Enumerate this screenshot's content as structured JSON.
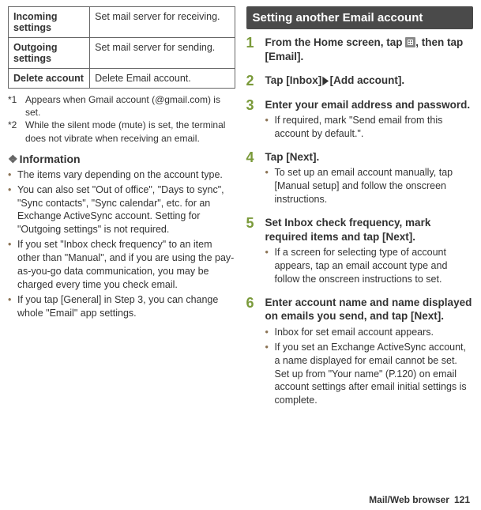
{
  "table": {
    "r1c1": "Incoming settings",
    "r1c2": "Set mail server for receiving.",
    "r2c1": "Outgoing settings",
    "r2c2": "Set mail server for sending.",
    "r3c1": "Delete account",
    "r3c2": "Delete Email account."
  },
  "foot": {
    "n1": "*1",
    "t1": "Appears when Gmail account (@gmail.com) is set.",
    "n2": "*2",
    "t2": "While the silent mode (mute) is set, the terminal does not vibrate when receiving an email."
  },
  "info": {
    "h": "Information",
    "b1": "The items vary depending on the account type.",
    "b2": "You can also set \"Out of office\", \"Days to sync\", \"Sync contacts\", \"Sync calendar\", etc. for an Exchange ActiveSync account. Setting for \"Outgoing settings\" is not required.",
    "b3": "If you set \"Inbox check frequency\" to an item other than \"Manual\", and if you are using the pay-as-you-go data communication, you may be charged every time you check email.",
    "b4": "If you tap [General] in Step 3, you can change whole \"Email\" app settings."
  },
  "banner": "Setting another Email account",
  "steps": {
    "s1": {
      "n": "1",
      "t_a": "From the Home screen, tap ",
      "t_b": ", then tap [Email]."
    },
    "s2": {
      "n": "2",
      "t_a": "Tap [Inbox]",
      "t_b": "[Add account]."
    },
    "s3": {
      "n": "3",
      "t": "Enter your email address and password.",
      "b1": "If required, mark \"Send email from this account by default.\"."
    },
    "s4": {
      "n": "4",
      "t": "Tap [Next].",
      "b1": "To set up an email account manually, tap [Manual setup] and follow the onscreen instructions."
    },
    "s5": {
      "n": "5",
      "t": "Set Inbox check frequency, mark required items and tap [Next].",
      "b1": "If a screen for selecting type of account appears, tap an email account type and follow the onscreen instructions to set."
    },
    "s6": {
      "n": "6",
      "t": "Enter account name and name displayed on emails you send, and tap [Next].",
      "b1": "Inbox for set email account appears.",
      "b2": "If you set an Exchange ActiveSync account, a name displayed for email cannot be set. Set up from \"Your name\" (P.120) on email account settings after email initial settings is complete."
    }
  },
  "footer": {
    "sec": "Mail/Web browser",
    "pn": "121"
  }
}
